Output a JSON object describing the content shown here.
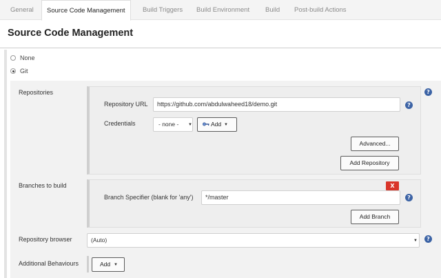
{
  "tabs": [
    {
      "label": "General",
      "active": false
    },
    {
      "label": "Source Code Management",
      "active": true
    },
    {
      "label": "Build Triggers",
      "active": false
    },
    {
      "label": "Build Environment",
      "active": false
    },
    {
      "label": "Build",
      "active": false
    },
    {
      "label": "Post-build Actions",
      "active": false
    }
  ],
  "page_title": "Source Code Management",
  "scm": {
    "options": [
      {
        "label": "None",
        "selected": false
      },
      {
        "label": "Git",
        "selected": true
      }
    ]
  },
  "repositories": {
    "label": "Repositories",
    "url_label": "Repository URL",
    "url_value": "https://github.com/abdulwaheed18/demo.git",
    "credentials_label": "Credentials",
    "credentials_value": "- none -",
    "add_label": "Add",
    "advanced_label": "Advanced...",
    "add_repository_label": "Add Repository"
  },
  "branches": {
    "label": "Branches to build",
    "delete_label": "X",
    "specifier_label": "Branch Specifier (blank for 'any')",
    "specifier_value": "*/master",
    "add_branch_label": "Add Branch"
  },
  "repository_browser": {
    "label": "Repository browser",
    "value": "(Auto)"
  },
  "additional_behaviours": {
    "label": "Additional Behaviours",
    "add_label": "Add"
  },
  "help_glyph": "?",
  "icons": [
    "help-icon",
    "key-icon",
    "dropdown-caret-icon",
    "delete-icon"
  ],
  "colors": {
    "help_icon": "#3c63a5",
    "delete_button": "#d9352a",
    "tab_bar": "#f4f4f4",
    "panel": "#f2f2f2"
  }
}
